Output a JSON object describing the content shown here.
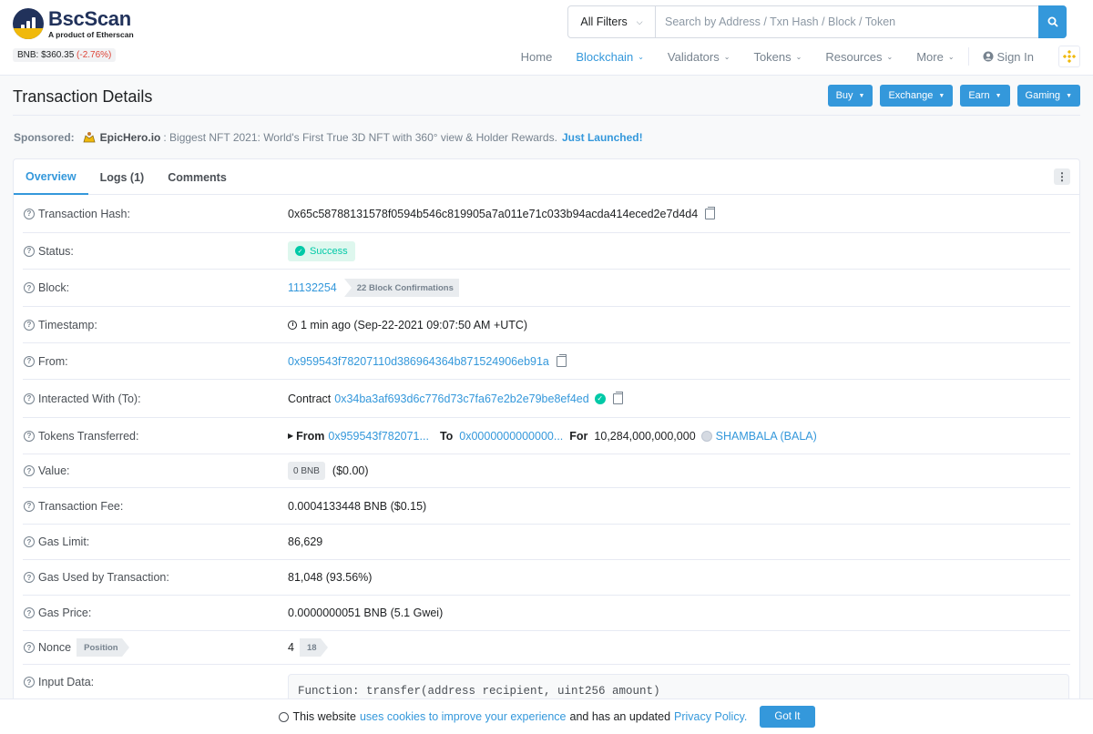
{
  "brand": {
    "title": "BscScan",
    "subtitle": "A product of Etherscan"
  },
  "price": {
    "label": "BNB: $360.35",
    "change": "(-2.76%)"
  },
  "search": {
    "filter": "All Filters",
    "placeholder": "Search by Address / Txn Hash / Block / Token"
  },
  "nav": {
    "items": [
      "Home",
      "Blockchain",
      "Validators",
      "Tokens",
      "Resources",
      "More"
    ],
    "signin": "Sign In"
  },
  "page": {
    "title": "Transaction Details"
  },
  "topbuttons": [
    "Buy",
    "Exchange",
    "Earn",
    "Gaming"
  ],
  "sponsor": {
    "label": "Sponsored:",
    "name": "EpicHero.io",
    "text": ": Biggest NFT 2021: World's First True 3D NFT with 360° view & Holder Rewards.",
    "cta": "Just Launched!"
  },
  "tabs": [
    "Overview",
    "Logs (1)",
    "Comments"
  ],
  "details": {
    "hash": {
      "label": "Transaction Hash:",
      "value": "0x65c58788131578f0594b546c819905a7a011e71c033b94acda414eced2e7d4d4"
    },
    "status": {
      "label": "Status:",
      "value": "Success"
    },
    "block": {
      "label": "Block:",
      "value": "11132254",
      "confirmations": "22 Block Confirmations"
    },
    "timestamp": {
      "label": "Timestamp:",
      "value": "1 min ago (Sep-22-2021 09:07:50 AM +UTC)"
    },
    "from": {
      "label": "From:",
      "value": "0x959543f78207110d386964364b871524906eb91a"
    },
    "to": {
      "label": "Interacted With (To):",
      "prefix": "Contract",
      "value": "0x34ba3af693d6c776d73c7fa67e2b2e79be8ef4ed"
    },
    "tokens": {
      "label": "Tokens Transferred:",
      "from_label": "From",
      "from": "0x959543f782071...",
      "to_label": "To",
      "to": "0x0000000000000...",
      "for_label": "For",
      "amount": "10,284,000,000,000",
      "token": "SHAMBALA (BALA)"
    },
    "value": {
      "label": "Value:",
      "tag": "0 BNB",
      "usd": "($0.00)"
    },
    "fee": {
      "label": "Transaction Fee:",
      "value": "0.0004133448 BNB ($0.15)"
    },
    "gas_limit": {
      "label": "Gas Limit:",
      "value": "86,629"
    },
    "gas_used": {
      "label": "Gas Used by Transaction:",
      "value": "81,048 (93.56%)"
    },
    "gas_price": {
      "label": "Gas Price:",
      "value": "0.0000000051 BNB (5.1 Gwei)"
    },
    "nonce": {
      "label": "Nonce",
      "tag": "Position",
      "value": "4",
      "position": "18"
    },
    "input": {
      "label": "Input Data:",
      "value": "Function: transfer(address recipient, uint256 amount)"
    }
  },
  "cookie": {
    "text1": "This website",
    "link1": "uses cookies to improve your experience",
    "text2": "and has an updated",
    "link2": "Privacy Policy.",
    "button": "Got It"
  },
  "colors": {
    "accent": "#3498db",
    "success": "#00c9a7",
    "negative": "#de4437",
    "brand": "#21325b",
    "bnb": "#f0b90b"
  }
}
